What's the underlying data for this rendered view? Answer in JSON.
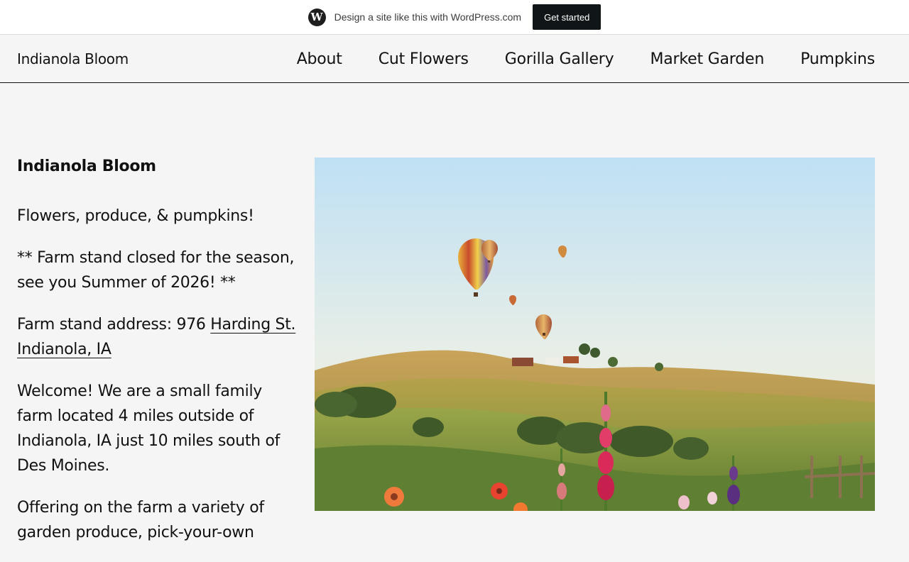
{
  "promo_bar": {
    "logo_icon": "wordpress-icon",
    "text": "Design a site like this with WordPress.com",
    "button_label": "Get started"
  },
  "header": {
    "site_title": "Indianola Bloom",
    "nav": [
      {
        "label": "About"
      },
      {
        "label": "Cut Flowers"
      },
      {
        "label": "Gorilla Gallery"
      },
      {
        "label": "Market Garden"
      },
      {
        "label": "Pumpkins"
      }
    ]
  },
  "main": {
    "blog_name": "Indianola Bloom",
    "tagline": "Flowers, produce, & pumpkins!",
    "notice": "** Farm stand closed for the season, see you Summer of 2026! **",
    "address_prefix": "Farm stand address: 976 ",
    "address_link": "Harding St. Indianola, IA",
    "welcome": "Welcome! We are a small family farm located 4 miles outside of Indianola, IA just 10 miles south of Des Moines.",
    "offering": "Offering on the farm a variety of garden produce, pick-your-own"
  },
  "colors": {
    "background": "#f5f5f5",
    "text": "#111111",
    "promo_button": "#101517"
  }
}
